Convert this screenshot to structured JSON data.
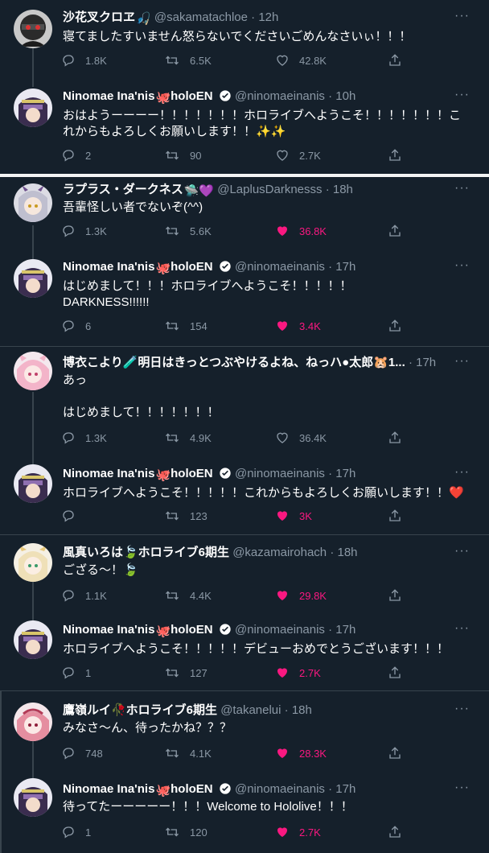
{
  "colors": {
    "background": "#15202b",
    "text": "#ffffff",
    "muted": "#8b98a5",
    "like": "#f91880",
    "verified": "#ffffff"
  },
  "icons": {
    "reply": "reply-icon",
    "retweet": "retweet-icon",
    "like": "heart-icon",
    "share": "share-icon",
    "more": "more-icon"
  },
  "blocks": [
    {
      "tweets": [
        {
          "name": "沙花叉クロヱ",
          "emoji": "🎣",
          "handle": "@sakamatachloe",
          "time": "12h",
          "text": "寝てましたすいません怒らないでくださいごめんなさいぃ！！！",
          "reply": "1.8K",
          "retweet": "6.5K",
          "like": "42.8K",
          "liked": false
        },
        {
          "name": "Ninomae Ina'nis",
          "emoji": "🐙",
          "suffix": "holoEN",
          "handle": "@ninomaeinanis",
          "time": "10h",
          "text": "おはようーーーー！！！！！！！ホロライブへようこそ！！！！！！！これからもよろしくお願いします！！✨✨",
          "reply": "2",
          "retweet": "90",
          "like": "2.7K",
          "liked": false
        }
      ]
    },
    {
      "tweets": [
        {
          "name": "ラプラス・ダークネス",
          "emoji": "🛸💜",
          "handle": "@LaplusDarknesss",
          "time": "18h",
          "text": "吾輩怪しい者でないぞ(^^)",
          "reply": "1.3K",
          "retweet": "5.6K",
          "like": "36.8K",
          "liked": true
        },
        {
          "name": "Ninomae Ina'nis",
          "emoji": "🐙",
          "suffix": "holoEN",
          "handle": "@ninomaeinanis",
          "time": "17h",
          "text": "はじめまして！！！ホロライブへようこそ！！！！！\nDARKNESS!!!!!!",
          "reply": "6",
          "retweet": "154",
          "like": "3.4K",
          "liked": true
        }
      ]
    },
    {
      "tweets": [
        {
          "name": "博衣こより🧪明日はきっとつぶやけるよね、ねっハ●太郎🐹1...",
          "emoji": "",
          "handle": "",
          "time": "17h",
          "text": "あっ\n\nはじめまして！！！！！！！",
          "reply": "1.3K",
          "retweet": "4.9K",
          "like": "36.4K",
          "liked": false
        },
        {
          "name": "Ninomae Ina'nis",
          "emoji": "🐙",
          "suffix": "holoEN",
          "handle": "@ninomaeinanis",
          "time": "17h",
          "text": "ホロライブへようこそ！！！！！これからもよろしくお願いします！！❤️",
          "reply": "",
          "retweet": "123",
          "like": "3K",
          "liked": true
        }
      ]
    },
    {
      "tweets": [
        {
          "name": "風真いろは🍃ホロライブ6期生",
          "emoji": "",
          "handle": "@kazamairohach",
          "time": "18h",
          "text": "ござる～！🍃",
          "reply": "1.1K",
          "retweet": "4.4K",
          "like": "29.8K",
          "liked": true
        },
        {
          "name": "Ninomae Ina'nis",
          "emoji": "🐙",
          "suffix": "holoEN",
          "handle": "@ninomaeinanis",
          "time": "17h",
          "text": "ホロライブへようこそ！！！！！デビューおめでとうございます！！！",
          "reply": "1",
          "retweet": "127",
          "like": "2.7K",
          "liked": true
        }
      ]
    },
    {
      "tweets": [
        {
          "name": "鷹嶺ルイ🥀ホロライブ6期生",
          "emoji": "",
          "handle": "@takanelui",
          "time": "18h",
          "text": "みなさ～ん、待ったかね？？？",
          "reply": "748",
          "retweet": "4.1K",
          "like": "28.3K",
          "liked": true
        },
        {
          "name": "Ninomae Ina'nis",
          "emoji": "🐙",
          "suffix": "holoEN",
          "handle": "@ninomaeinanis",
          "time": "17h",
          "text": "待ってたーーーーー！！！Welcome to Hololive！！！",
          "reply": "1",
          "retweet": "120",
          "like": "2.7K",
          "liked": true
        }
      ]
    }
  ]
}
